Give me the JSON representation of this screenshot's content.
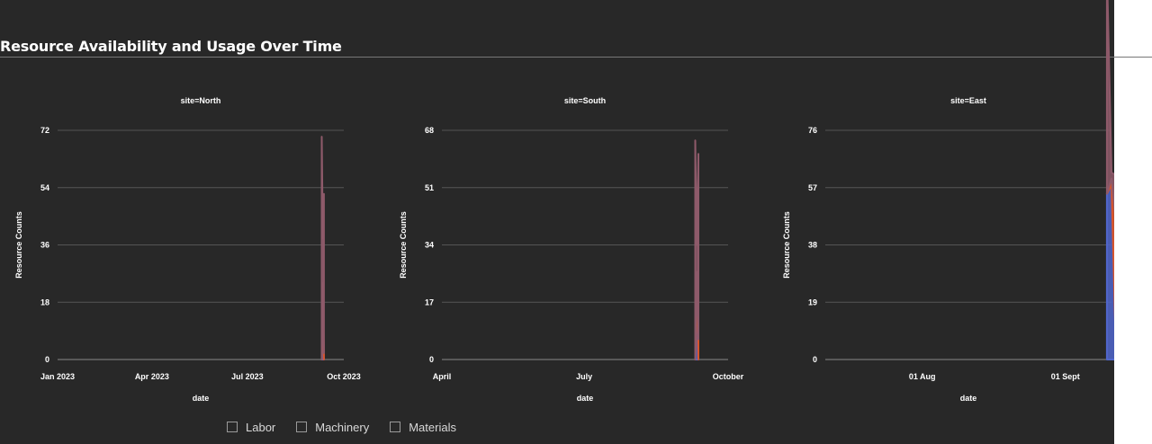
{
  "title": "Resource Availability and Usage Over Time",
  "legend": {
    "items": [
      {
        "label": "Labor",
        "color": "#5066cc"
      },
      {
        "label": "Machinery",
        "color": "#d8552c"
      },
      {
        "label": "Materials",
        "color": "#8e5a6a"
      }
    ]
  },
  "chart_data": [
    {
      "type": "area",
      "title": "site=North",
      "xlabel": "date",
      "ylabel": "Resource Counts",
      "x_range": [
        "2023-01-01",
        "2023-10-01"
      ],
      "x_ticks": [
        {
          "date": "2023-01-01",
          "label": "Jan 2023"
        },
        {
          "date": "2023-04-01",
          "label": "Apr 2023"
        },
        {
          "date": "2023-07-01",
          "label": "Jul 2023"
        },
        {
          "date": "2023-10-01",
          "label": "Oct 2023"
        }
      ],
      "ylim": [
        0,
        72
      ],
      "y_ticks": [
        0,
        18,
        36,
        54,
        72
      ],
      "x": [
        "2023-09-10",
        "2023-09-11",
        "2023-09-12"
      ],
      "series": [
        {
          "name": "Labor",
          "values": [
            0,
            20,
            0
          ]
        },
        {
          "name": "Machinery",
          "values": [
            0,
            4,
            2
          ]
        },
        {
          "name": "Materials",
          "values": [
            70,
            14,
            50
          ]
        }
      ]
    },
    {
      "type": "area",
      "title": "site=South",
      "xlabel": "date",
      "ylabel": "Resource Counts",
      "x_range": [
        "2023-04-01",
        "2023-10-01"
      ],
      "x_ticks": [
        {
          "date": "2023-04-01",
          "label": "April"
        },
        {
          "date": "2023-07-01",
          "label": "July"
        },
        {
          "date": "2023-10-01",
          "label": "October"
        }
      ],
      "ylim": [
        0,
        68
      ],
      "y_ticks": [
        0,
        17,
        34,
        51,
        68
      ],
      "x": [
        "2023-09-10",
        "2023-09-11",
        "2023-09-12"
      ],
      "series": [
        {
          "name": "Labor",
          "values": [
            0,
            24,
            0
          ]
        },
        {
          "name": "Machinery",
          "values": [
            0,
            2,
            6
          ]
        },
        {
          "name": "Materials",
          "values": [
            65,
            8,
            55
          ]
        }
      ]
    },
    {
      "type": "area",
      "title": "site=East",
      "xlabel": "date",
      "ylabel": "Resource Counts",
      "x_range": [
        "2023-07-11",
        "2023-09-11"
      ],
      "x_ticks": [
        {
          "date": "2023-08-01",
          "label": "01 Aug"
        },
        {
          "date": "2023-09-01",
          "label": "01 Sept"
        }
      ],
      "ylim": [
        0,
        76
      ],
      "y_ticks": [
        0,
        19,
        38,
        57,
        76
      ],
      "x": [
        "2023-09-10",
        "2023-09-11",
        "2023-09-12"
      ],
      "series": [
        {
          "name": "Labor",
          "values": [
            55,
            58,
            0
          ]
        },
        {
          "name": "Machinery",
          "values": [
            0,
            2,
            45
          ]
        },
        {
          "name": "Materials",
          "values": [
            75,
            2,
            16
          ]
        }
      ]
    }
  ]
}
